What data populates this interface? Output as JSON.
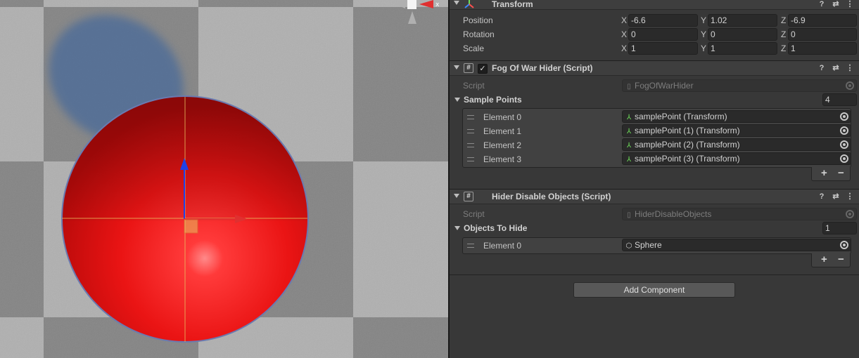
{
  "transform": {
    "title": "Transform",
    "position": {
      "label": "Position",
      "x": "-6.6",
      "y": "1.02",
      "z": "-6.9"
    },
    "rotation": {
      "label": "Rotation",
      "x": "0",
      "y": "0",
      "z": "0"
    },
    "scale": {
      "label": "Scale",
      "x": "1",
      "y": "1",
      "z": "1"
    },
    "axis_x": "X",
    "axis_y": "Y",
    "axis_z": "Z"
  },
  "fog_of_war_hider": {
    "title": "Fog Of War Hider (Script)",
    "enabled_mark": "✓",
    "script_label": "Script",
    "script_value": "FogOfWarHider",
    "list_label": "Sample Points",
    "list_count": "4",
    "elements": [
      {
        "label": "Element 0",
        "value": "samplePoint (Transform)"
      },
      {
        "label": "Element 1",
        "value": "samplePoint (1) (Transform)"
      },
      {
        "label": "Element 2",
        "value": "samplePoint (2) (Transform)"
      },
      {
        "label": "Element 3",
        "value": "samplePoint (3) (Transform)"
      }
    ]
  },
  "hider_disable_objects": {
    "title": "Hider Disable Objects (Script)",
    "script_label": "Script",
    "script_value": "HiderDisableObjects",
    "list_label": "Objects To Hide",
    "list_count": "1",
    "elements": [
      {
        "label": "Element 0",
        "value": "Sphere"
      }
    ]
  },
  "list_footer": {
    "add": "+",
    "remove": "−"
  },
  "header_buttons": {
    "help": "?",
    "presets": "⇄",
    "menu": "⋮"
  },
  "add_component_label": "Add Component",
  "scene": {
    "gizmo_axis_label": "x"
  },
  "colors": {
    "sphere": "#e81818",
    "selection_outline": "#5a7ab8",
    "x_axis": "#e03030",
    "y_axis": "#2040e8",
    "inspector_bg": "#383838"
  },
  "icons": {
    "transform": "transform-axes-icon",
    "script": "hash-script-icon",
    "script_file": "document-icon",
    "object_picker": "target-circle-icon",
    "mesh": "cube-icon"
  }
}
